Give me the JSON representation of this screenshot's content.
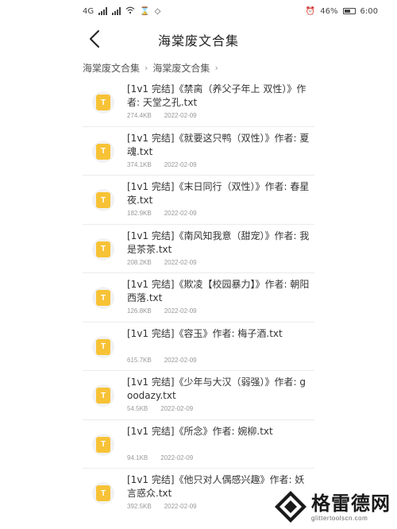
{
  "status_bar": {
    "network": "4G",
    "battery_percent": "46%",
    "time": "6:00"
  },
  "header": {
    "title": "海棠废文合集",
    "back_icon": "chevron-left-icon"
  },
  "breadcrumb": [
    {
      "label": "海棠废文合集"
    },
    {
      "label": "海棠废文合集"
    }
  ],
  "files": [
    {
      "name": "[1v1 完结]《禁脔（养父子年上 双性）》作者: 天堂之孔.txt",
      "size": "274.4KB",
      "date": "2022-02-09"
    },
    {
      "name": "[1v1 完结]《就要这只鸭（双性）》作者: 夏魂.txt",
      "size": "374.1KB",
      "date": "2022-02-09"
    },
    {
      "name": "[1v1 完结]《末日同行（双性）》作者: 春星夜.txt",
      "size": "182.9KB",
      "date": "2022-02-09"
    },
    {
      "name": "[1v1 完结]《南风知我意（甜宠）》作者: 我是茶茶.txt",
      "size": "208.2KB",
      "date": "2022-02-09"
    },
    {
      "name": "[1v1 完结]《欺凌【校园暴力】》作者: 朝阳西落.txt",
      "size": "126.8KB",
      "date": "2022-02-09"
    },
    {
      "name": "[1v1 完结]《容玉》作者: 梅子酒.txt",
      "size": "615.7KB",
      "date": "2022-02-09"
    },
    {
      "name": "[1v1 完结]《少年与大汉（弱强）》作者: goodazy.txt",
      "size": "54.5KB",
      "date": "2022-02-09"
    },
    {
      "name": "[1v1 完结]《所念》作者: 婉柳.txt",
      "size": "94.1KB",
      "date": "2022-02-09"
    },
    {
      "name": "[1v1 完结]《他只对人偶感兴趣》作者: 妖言惑众.txt",
      "size": "392.5KB",
      "date": "2022-02-09"
    }
  ],
  "watermark": {
    "title": "格雷德网",
    "subtitle": "glittertoolscn.com"
  },
  "colors": {
    "file_icon": "#f7c235",
    "icon_bg": "#f2f2f2",
    "divider": "#ececec"
  }
}
